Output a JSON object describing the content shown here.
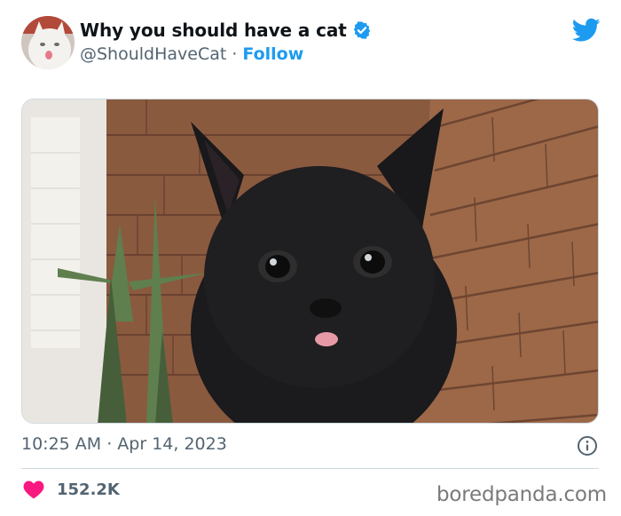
{
  "tweet": {
    "display_name": "Why you should have a cat",
    "handle": "@ShouldHaveCat",
    "separator": "·",
    "follow_label": "Follow",
    "timestamp": "10:25 AM · Apr 14, 2023",
    "like_count": "152.2K"
  },
  "icons": {
    "verified": "verified-badge-icon",
    "brand": "twitter-bird-icon",
    "info": "info-icon",
    "like": "heart-icon"
  },
  "watermark": "boredpanda.com",
  "colors": {
    "accent": "#1d9bf0",
    "text_primary": "#0f1419",
    "text_secondary": "#536471",
    "like": "#f91880",
    "divider": "#cfd9de"
  }
}
